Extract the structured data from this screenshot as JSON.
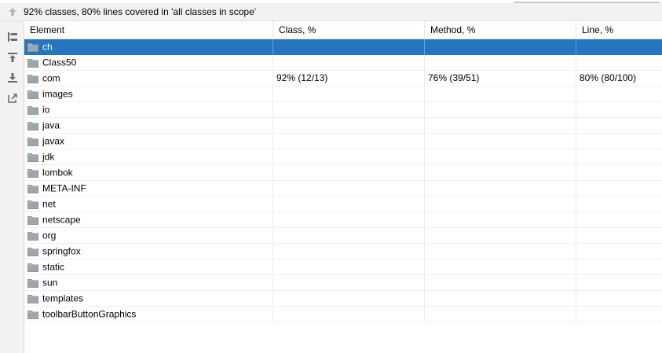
{
  "header": {
    "summary": "92% classes, 80% lines covered in 'all classes in scope'"
  },
  "toolbar": {
    "buttons": [
      "up-arrow-icon",
      "flatten-packages-icon",
      "import-icon",
      "export-icon",
      "open-external-icon"
    ]
  },
  "table": {
    "columns": [
      "Element",
      "Class, %",
      "Method, %",
      "Line, %"
    ],
    "rows": [
      {
        "name": "ch",
        "class": "",
        "method": "",
        "line": "",
        "selected": true
      },
      {
        "name": "Class50",
        "class": "",
        "method": "",
        "line": ""
      },
      {
        "name": "com",
        "class": "92% (12/13)",
        "method": "76% (39/51)",
        "line": "80% (80/100)"
      },
      {
        "name": "images",
        "class": "",
        "method": "",
        "line": ""
      },
      {
        "name": "io",
        "class": "",
        "method": "",
        "line": ""
      },
      {
        "name": "java",
        "class": "",
        "method": "",
        "line": ""
      },
      {
        "name": "javax",
        "class": "",
        "method": "",
        "line": ""
      },
      {
        "name": "jdk",
        "class": "",
        "method": "",
        "line": ""
      },
      {
        "name": "lombok",
        "class": "",
        "method": "",
        "line": ""
      },
      {
        "name": "META-INF",
        "class": "",
        "method": "",
        "line": ""
      },
      {
        "name": "net",
        "class": "",
        "method": "",
        "line": ""
      },
      {
        "name": "netscape",
        "class": "",
        "method": "",
        "line": ""
      },
      {
        "name": "org",
        "class": "",
        "method": "",
        "line": ""
      },
      {
        "name": "springfox",
        "class": "",
        "method": "",
        "line": ""
      },
      {
        "name": "static",
        "class": "",
        "method": "",
        "line": ""
      },
      {
        "name": "sun",
        "class": "",
        "method": "",
        "line": ""
      },
      {
        "name": "templates",
        "class": "",
        "method": "",
        "line": ""
      },
      {
        "name": "toolbarButtonGraphics",
        "class": "",
        "method": "",
        "line": ""
      }
    ]
  },
  "colors": {
    "selection": "#2675bf",
    "folder": "#9aa7b0",
    "panel": "#f2f2f2"
  }
}
